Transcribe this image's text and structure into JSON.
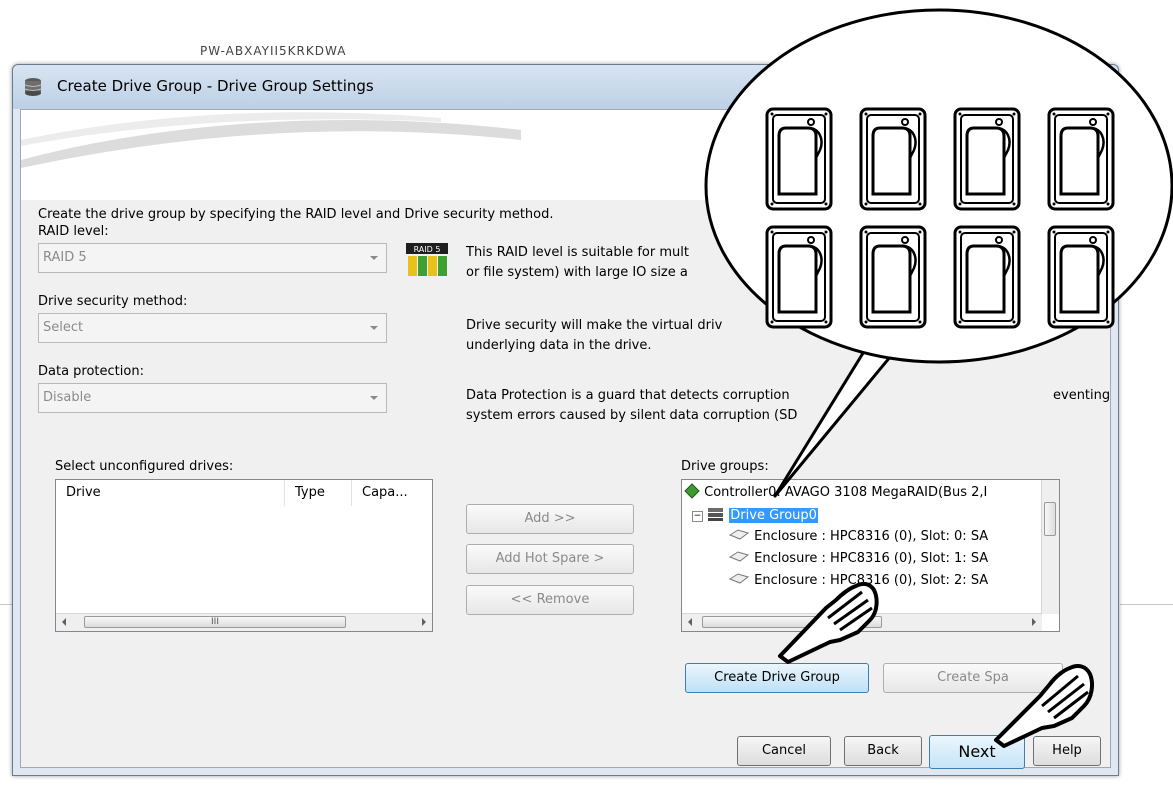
{
  "background": {
    "caption": "PW-ABXAYII5KRKDWA"
  },
  "window": {
    "title": "Create Drive Group - Drive Group Settings"
  },
  "instructions": "Create the drive group by specifying the RAID level and Drive security method.",
  "raid_level": {
    "label": "RAID level:",
    "value": "RAID 5",
    "badge": "RAID 5",
    "description": [
      "This RAID level is suitable for mult",
      "or file system) with large IO size a"
    ]
  },
  "security": {
    "label": "Drive security method:",
    "value": "Select",
    "description": [
      "Drive security will make the virtual driv",
      "underlying data in the drive."
    ]
  },
  "protection": {
    "label": "Data protection:",
    "value": "Disable",
    "description": [
      "Data Protection is a guard that detects corruption",
      "system errors caused by silent data corruption (SD",
      "eventing"
    ]
  },
  "unconfigured": {
    "label": "Select unconfigured drives:",
    "columns": [
      "Drive",
      "Type",
      "Capa..."
    ],
    "scroll_thumb_text": "III"
  },
  "actions": {
    "add": "Add >>",
    "add_hot_spare": "Add Hot Spare >",
    "remove": "<< Remove"
  },
  "drive_groups": {
    "label": "Drive groups:",
    "controller": "Controller0: AVAGO 3108 MegaRAID(Bus 2,I",
    "group": "Drive Group0",
    "drives": [
      "Enclosure : HPC8316 (0), Slot: 0: SA",
      "Enclosure : HPC8316 (0), Slot: 1: SA",
      "Enclosure : HPC8316 (0), Slot: 2: SA"
    ]
  },
  "group_buttons": {
    "create_drive_group": "Create Drive Group",
    "create_spare": "Create Spa"
  },
  "footer": {
    "cancel": "Cancel",
    "back": "Back",
    "next": "Next",
    "help": "Help"
  },
  "callout": {
    "drive_count": 8,
    "icon": "hard-drive-icon"
  },
  "colors": {
    "title_bar": "#c9d9ec",
    "selection": "#3399ff",
    "primary_button": "#bfe0f6"
  }
}
